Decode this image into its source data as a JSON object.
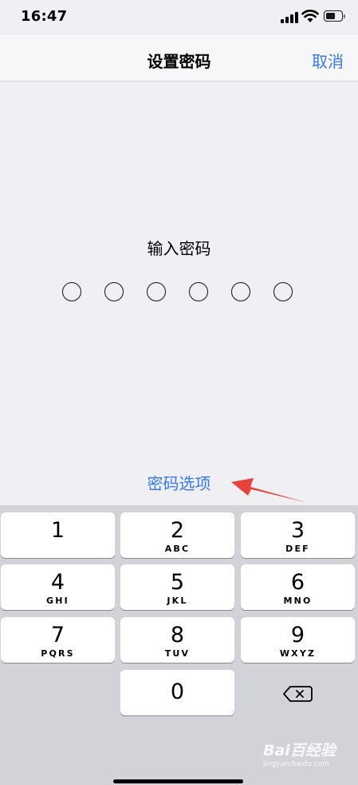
{
  "status_bar": {
    "time": "16:47",
    "icons": [
      "signal-icon",
      "wifi-icon",
      "battery-icon"
    ]
  },
  "nav": {
    "title": "设置密码",
    "cancel_label": "取消"
  },
  "passcode": {
    "prompt": "输入密码",
    "length": 6,
    "filled": 0
  },
  "options_label": "密码选项",
  "keypad": {
    "keys": [
      {
        "digit": "1",
        "letters": ""
      },
      {
        "digit": "2",
        "letters": "ABC"
      },
      {
        "digit": "3",
        "letters": "DEF"
      },
      {
        "digit": "4",
        "letters": "GHI"
      },
      {
        "digit": "5",
        "letters": "JKL"
      },
      {
        "digit": "6",
        "letters": "MNO"
      },
      {
        "digit": "7",
        "letters": "PQRS"
      },
      {
        "digit": "8",
        "letters": "TUV"
      },
      {
        "digit": "9",
        "letters": "WXYZ"
      },
      {
        "digit": "0",
        "letters": ""
      }
    ],
    "delete_icon": "backspace-icon"
  },
  "watermark": {
    "main": "Bai百经验",
    "sub": "jingyan.baidu.com"
  },
  "colors": {
    "accent": "#3478f6",
    "annotation": "#e8433a",
    "keyboard_bg": "#d1d3d9",
    "page_bg": "#efeff4"
  }
}
